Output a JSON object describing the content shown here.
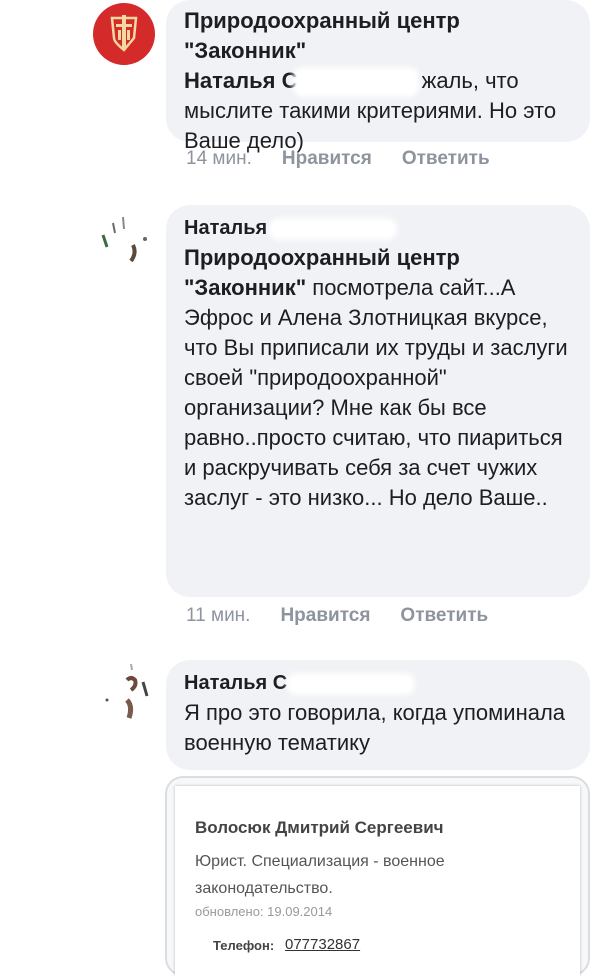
{
  "comments": [
    {
      "page_name": "Природоохранный центр \"Законник\"",
      "mention_start": "Наталья С",
      "text_after_redaction": "жаль, что мыслите такими критериями. Но это Ваше дело)",
      "time": "14 мин.",
      "like": "Нравится",
      "reply": "Ответить"
    },
    {
      "author": "Наталья",
      "mention": "Природоохранный центр \"Законник\"",
      "text": "посмотрела сайт...А Эфрос и Алена Злотницкая вкурсе, что Вы приписали их труды и заслуги своей \"природоохранной\" организации? Мне как бы все равно..просто считаю, что пиариться и раскручивать себя за счет чужих заслуг - это низко... Но дело Ваше..",
      "time": "11 мин.",
      "like": "Нравится",
      "reply": "Ответить"
    },
    {
      "author": "Наталья С",
      "text": "Я про это говорила, когда упоминала военную тематику"
    }
  ],
  "attachment": {
    "name": "Волосюк Дмитрий Сергеевич",
    "description": "Юрист. Специализация - военное законодательство.",
    "updated": "обновлено: 19.09.2014",
    "phone_label": "Телефон:",
    "phone": "077732867"
  },
  "colors": {
    "bubble": "#f0f2f5",
    "logo_red": "#d42a2a",
    "meta_gray": "#8d949e"
  },
  "icons": [
    "sword-shield-logo-icon",
    "user-photo-avatar"
  ]
}
